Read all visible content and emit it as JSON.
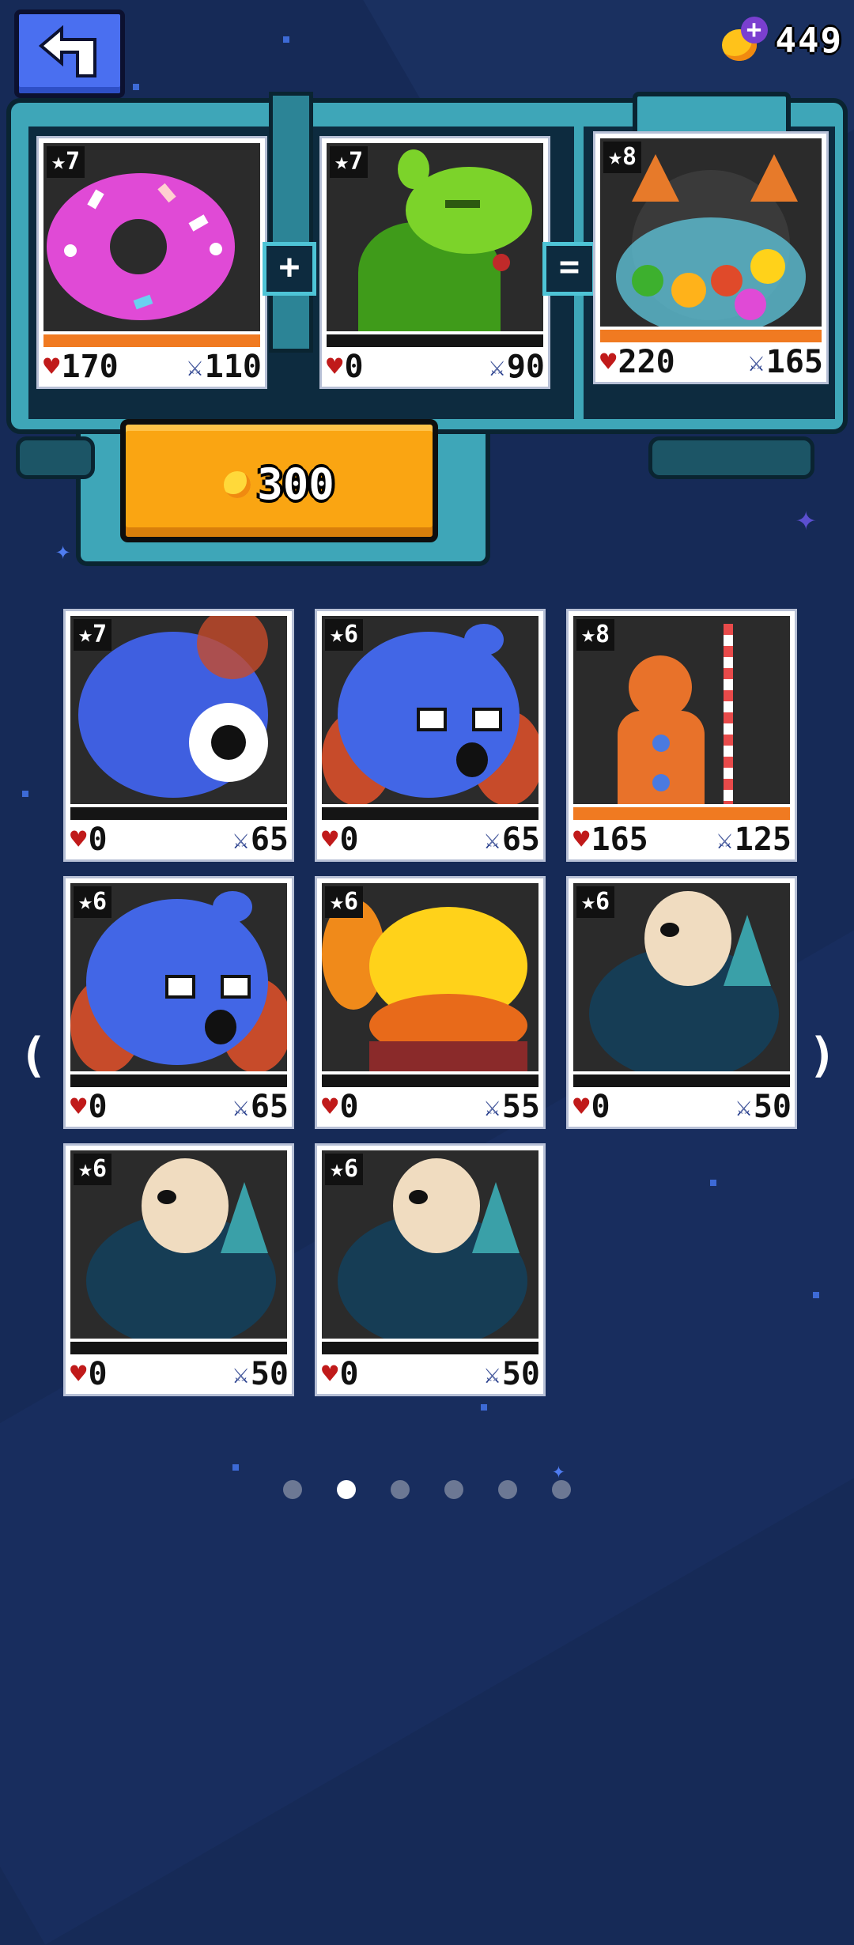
{
  "header": {
    "back_icon": "back-arrow-icon",
    "coin_count": "449",
    "coin_icon": "coin-plus-icon",
    "plus_symbol": "+"
  },
  "fusion": {
    "plus_symbol": "+",
    "equals_symbol": "=",
    "fuse_cost": "300",
    "slots": [
      {
        "level": "★7",
        "hp": "170",
        "atk": "110",
        "creature": "donut-monster",
        "bar_color": "#f07a21"
      },
      {
        "level": "★7",
        "hp": "0",
        "atk": "90",
        "creature": "green-dragon",
        "bar_color": "#151515"
      },
      {
        "level": "★8",
        "hp": "220",
        "atk": "165",
        "creature": "gumball-cat",
        "bar_color": "#f07a21"
      }
    ]
  },
  "collection": [
    {
      "level": "★7",
      "hp": "0",
      "atk": "65",
      "creature": "blue-flame-eye"
    },
    {
      "level": "★6",
      "hp": "0",
      "atk": "65",
      "creature": "blue-bear"
    },
    {
      "level": "★8",
      "hp": "165",
      "atk": "125",
      "creature": "gingerbread-man"
    },
    {
      "level": "★6",
      "hp": "0",
      "atk": "65",
      "creature": "blue-bear"
    },
    {
      "level": "★6",
      "hp": "0",
      "atk": "55",
      "creature": "yellow-crab"
    },
    {
      "level": "★6",
      "hp": "0",
      "atk": "50",
      "creature": "teal-seal"
    },
    {
      "level": "★6",
      "hp": "0",
      "atk": "50",
      "creature": "teal-seal"
    },
    {
      "level": "★6",
      "hp": "0",
      "atk": "50",
      "creature": "teal-seal"
    }
  ],
  "symbols": {
    "heart": "♥",
    "sword": "⚔"
  },
  "nav": {
    "prev_arrow": "(",
    "next_arrow": ")",
    "page_count": 6,
    "active_page": 2
  }
}
